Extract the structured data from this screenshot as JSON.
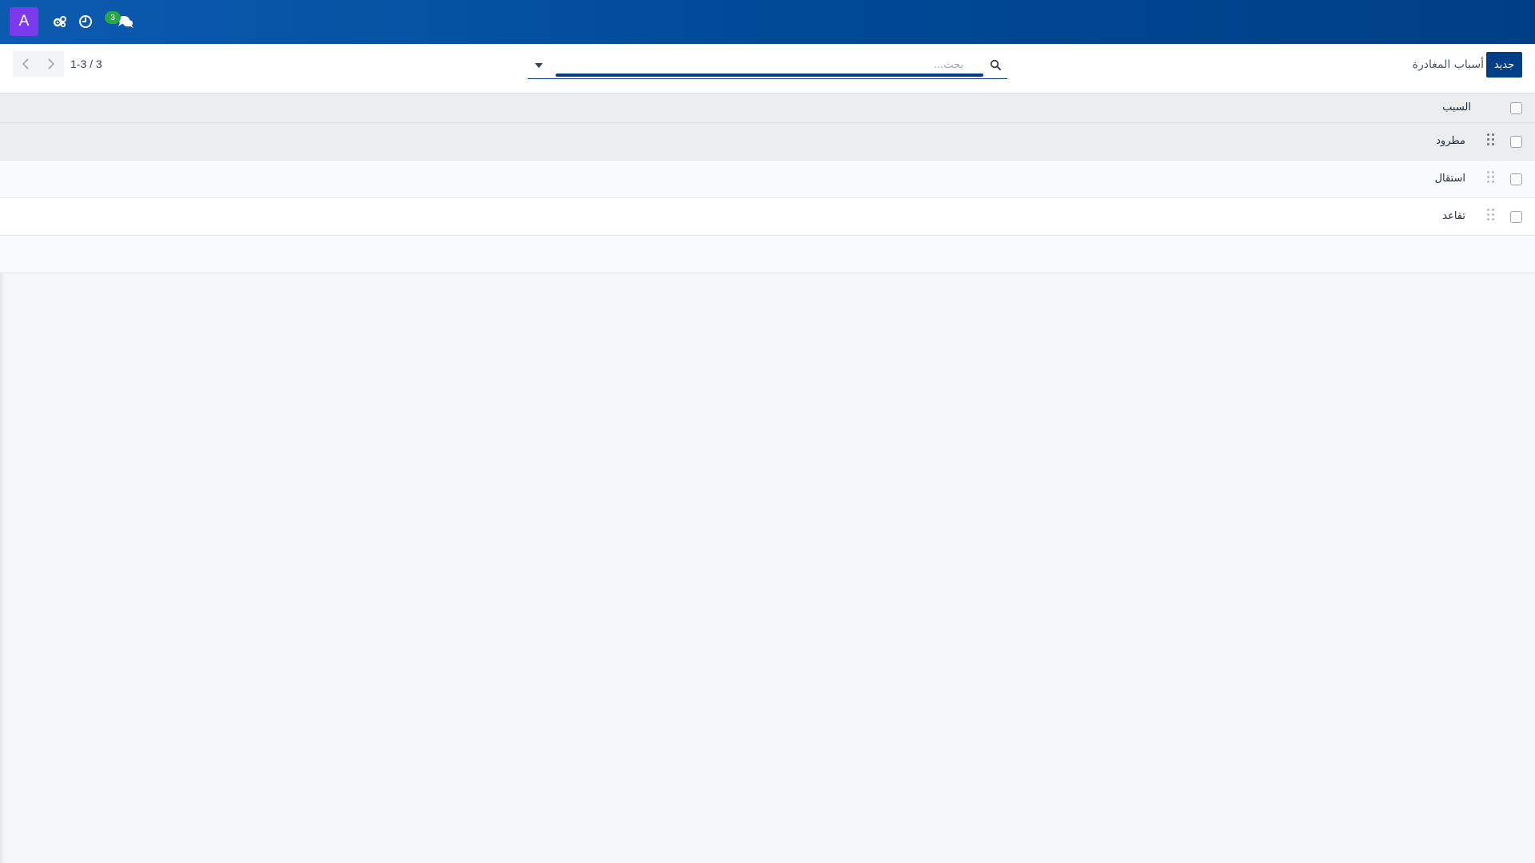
{
  "navbar": {
    "avatar_letter": "A",
    "messages_count": "3",
    "colors": {
      "navbar": "#004a98",
      "avatar": "#7c3aed",
      "badge": "#28a745"
    },
    "icons": [
      "gears-icon",
      "clock-icon",
      "chat-icon"
    ]
  },
  "control_panel": {
    "new_button_label": "جديد",
    "breadcrumb": "أسباب المغادرة",
    "search": {
      "placeholder": "بحث...",
      "value": ""
    },
    "pager": {
      "range": "1-3 / 3"
    }
  },
  "list": {
    "column_header": "السبب",
    "rows": [
      {
        "reason": "مطرود"
      },
      {
        "reason": "استقال"
      },
      {
        "reason": "تقاعد"
      }
    ]
  }
}
